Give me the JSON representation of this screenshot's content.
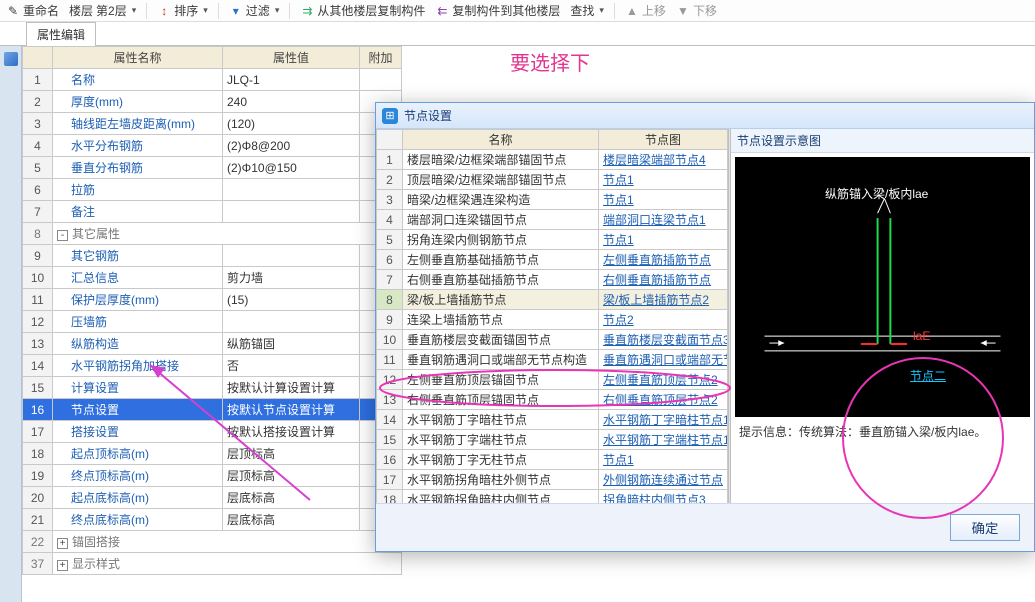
{
  "toolbar": {
    "rename": "重命名",
    "floor_label": "楼层",
    "floor_value": "第2层",
    "sort": "排序",
    "filter": "过滤",
    "copy_from": "从其他楼层复制构件",
    "copy_to": "复制构件到其他楼层",
    "find": "查找",
    "move_up": "上移",
    "move_down": "下移"
  },
  "tab": {
    "label": "属性编辑"
  },
  "annot_text": "要选择下",
  "pgrid": {
    "cols": {
      "name": "属性名称",
      "value": "属性值",
      "extra": "附加"
    },
    "rows": [
      {
        "n": "1",
        "name": "名称",
        "value": "JLQ-1"
      },
      {
        "n": "2",
        "name": "厚度(mm)",
        "value": "240"
      },
      {
        "n": "3",
        "name": "轴线距左墙皮距离(mm)",
        "value": "(120)"
      },
      {
        "n": "4",
        "name": "水平分布钢筋",
        "value": "(2)Φ8@200"
      },
      {
        "n": "5",
        "name": "垂直分布钢筋",
        "value": "(2)Φ10@150"
      },
      {
        "n": "6",
        "name": "拉筋",
        "value": ""
      },
      {
        "n": "7",
        "name": "备注",
        "value": ""
      },
      {
        "n": "8",
        "group": true,
        "exp": "-",
        "name": "其它属性"
      },
      {
        "n": "9",
        "name": "其它钢筋",
        "value": ""
      },
      {
        "n": "10",
        "name": "汇总信息",
        "value": "剪力墙"
      },
      {
        "n": "11",
        "name": "保护层厚度(mm)",
        "value": "(15)"
      },
      {
        "n": "12",
        "name": "压墙筋",
        "value": ""
      },
      {
        "n": "13",
        "name": "纵筋构造",
        "value": "纵筋锚固"
      },
      {
        "n": "14",
        "name": "水平钢筋拐角加搭接",
        "value": "否"
      },
      {
        "n": "15",
        "name": "计算设置",
        "value": "按默认计算设置计算"
      },
      {
        "n": "16",
        "name": "节点设置",
        "value": "按默认节点设置计算",
        "sel": true
      },
      {
        "n": "17",
        "name": "搭接设置",
        "value": "按默认搭接设置计算"
      },
      {
        "n": "18",
        "name": "起点顶标高(m)",
        "value": "层顶标高"
      },
      {
        "n": "19",
        "name": "终点顶标高(m)",
        "value": "层顶标高"
      },
      {
        "n": "20",
        "name": "起点底标高(m)",
        "value": "层底标高"
      },
      {
        "n": "21",
        "name": "终点底标高(m)",
        "value": "层底标高"
      },
      {
        "n": "22",
        "group": true,
        "exp": "+",
        "name": "锚固搭接"
      },
      {
        "n": "37",
        "group": true,
        "exp": "+",
        "name": "显示样式"
      }
    ]
  },
  "dialog": {
    "title": "节点设置",
    "right_header": "节点设置示意图",
    "hint_label": "提示信息：",
    "hint_text": "传统算法：垂直筋锚入梁/板内lae。",
    "ok": "确定",
    "diagram_top": "纵筋锚入梁/板内lae",
    "diagram_mid": "laE",
    "diagram_btn": "节点二",
    "cols": {
      "name": "名称",
      "img": "节点图"
    },
    "rows": [
      {
        "n": "1",
        "name": "楼层暗梁/边框梁端部锚固节点",
        "img": "楼层暗梁端部节点4"
      },
      {
        "n": "2",
        "name": "顶层暗梁/边框梁端部锚固节点",
        "img": "节点1"
      },
      {
        "n": "3",
        "name": "暗梁/边框梁遇连梁构造",
        "img": "节点1"
      },
      {
        "n": "4",
        "name": "端部洞口连梁锚固节点",
        "img": "端部洞口连梁节点1"
      },
      {
        "n": "5",
        "name": "拐角连梁内侧钢筋节点",
        "img": "节点1"
      },
      {
        "n": "6",
        "name": "左侧垂直筋基础插筋节点",
        "img": "左侧垂直筋插筋节点"
      },
      {
        "n": "7",
        "name": "右侧垂直筋基础插筋节点",
        "img": "右侧垂直筋插筋节点"
      },
      {
        "n": "8",
        "name": "梁/板上墙插筋节点",
        "img": "梁/板上墙插筋节点2",
        "sel": true
      },
      {
        "n": "9",
        "name": "连梁上墙插筋节点",
        "img": "节点2"
      },
      {
        "n": "10",
        "name": "垂直筋楼层变截面锚固节点",
        "img": "垂直筋楼层变截面节点3"
      },
      {
        "n": "11",
        "name": "垂直钢筋遇洞口或端部无节点构造",
        "img": "垂直筋遇洞口或端部无节"
      },
      {
        "n": "12",
        "name": "左侧垂直筋顶层锚固节点",
        "img": "左侧垂直筋顶层节点2"
      },
      {
        "n": "13",
        "name": "右侧垂直筋顶层锚固节点",
        "img": "右侧垂直筋顶层节点2"
      },
      {
        "n": "14",
        "name": "水平钢筋丁字暗柱节点",
        "img": "水平钢筋丁字暗柱节点1"
      },
      {
        "n": "15",
        "name": "水平钢筋丁字端柱节点",
        "img": "水平钢筋丁字端柱节点1"
      },
      {
        "n": "16",
        "name": "水平钢筋丁字无柱节点",
        "img": "节点1"
      },
      {
        "n": "17",
        "name": "水平钢筋拐角暗柱外侧节点",
        "img": "外侧钢筋连续通过节点"
      },
      {
        "n": "18",
        "name": "水平钢筋拐角暗柱内侧节点",
        "img": "拐角暗柱内侧节点3"
      }
    ]
  }
}
